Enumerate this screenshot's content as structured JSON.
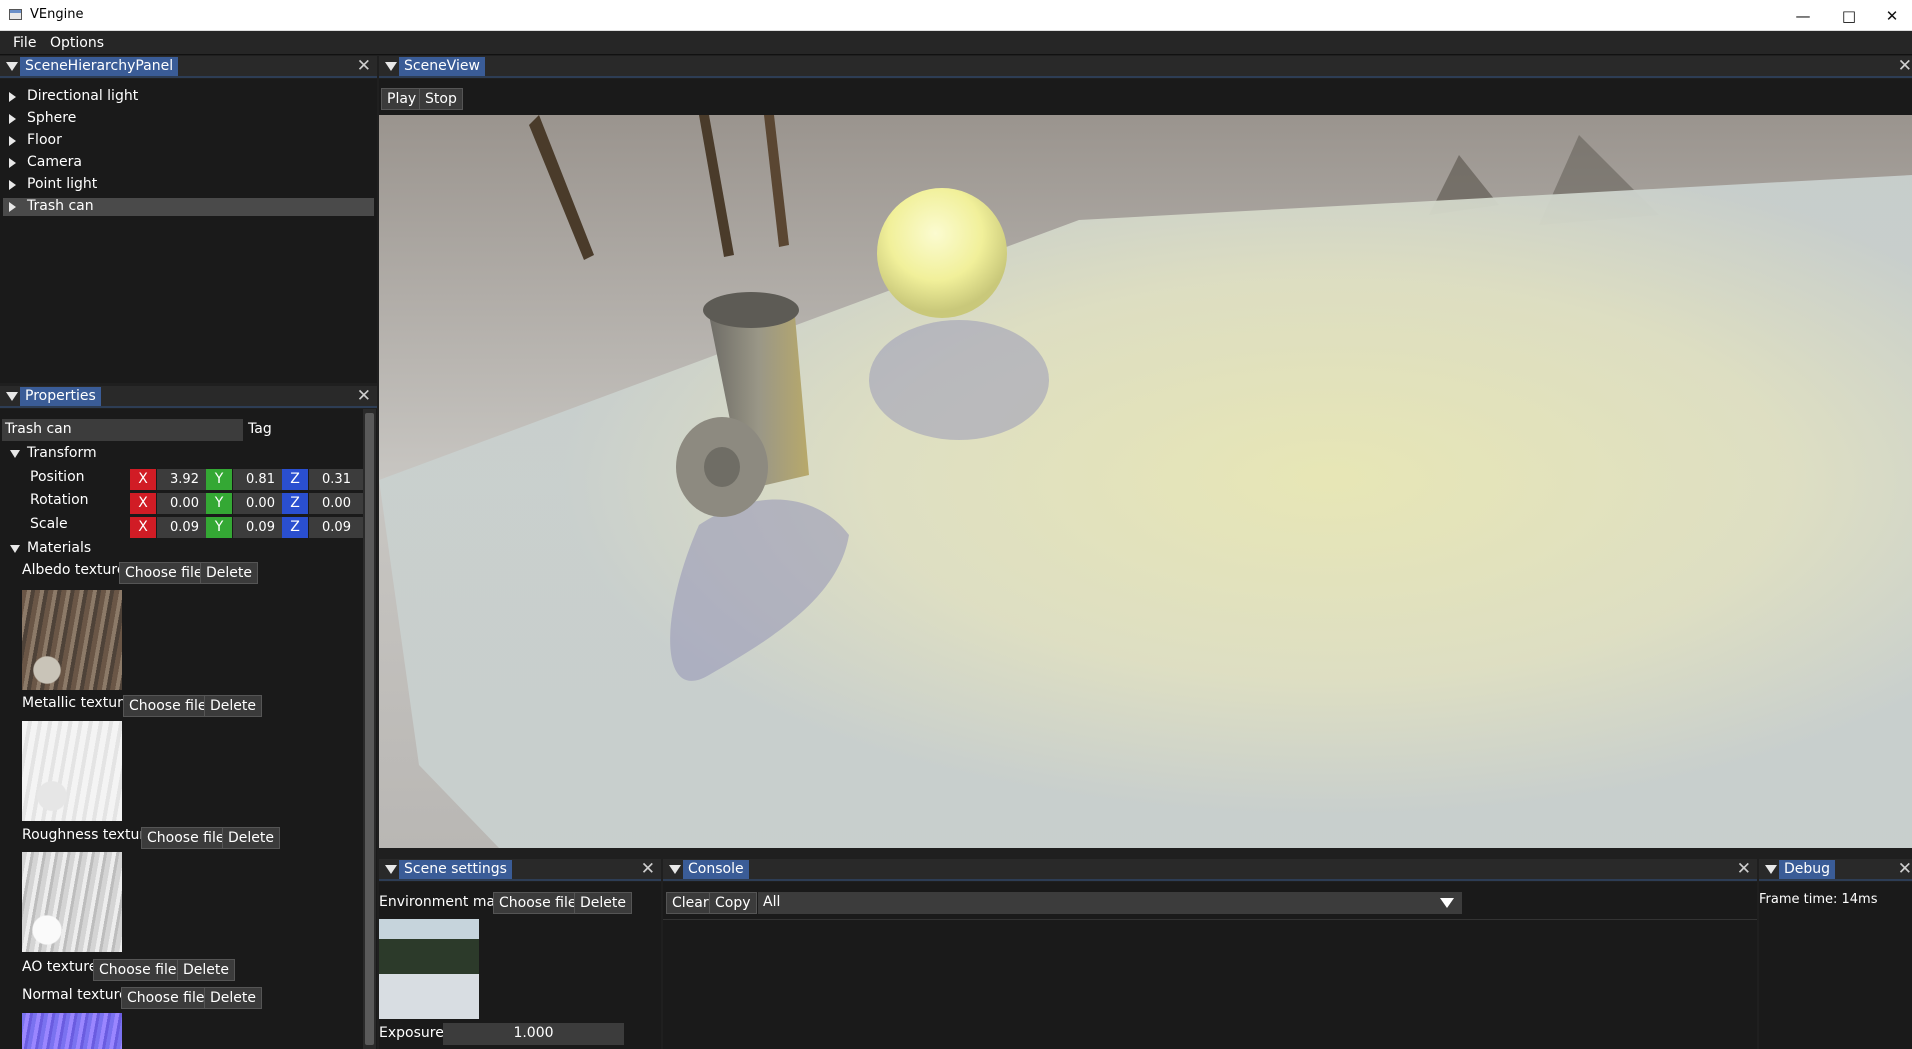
{
  "window": {
    "title": "VEngine"
  },
  "menu": {
    "file": "File",
    "options": "Options"
  },
  "hierarchy": {
    "tab": "SceneHierarchyPanel",
    "items": [
      {
        "label": "Directional light"
      },
      {
        "label": "Sphere"
      },
      {
        "label": "Floor"
      },
      {
        "label": "Camera"
      },
      {
        "label": "Point light"
      },
      {
        "label": "Trash can"
      }
    ],
    "selected": "Trash can"
  },
  "properties": {
    "tab": "Properties",
    "name_value": "Trash can",
    "tag_label": "Tag",
    "transform": {
      "title": "Transform",
      "rows": [
        {
          "label": "Position",
          "x": "3.92",
          "y": "0.81",
          "z": "0.31"
        },
        {
          "label": "Rotation",
          "x": "0.00",
          "y": "0.00",
          "z": "0.00"
        },
        {
          "label": "Scale",
          "x": "0.09",
          "y": "0.09",
          "z": "0.09"
        }
      ],
      "axis_x": "X",
      "axis_y": "Y",
      "axis_z": "Z"
    },
    "materials": {
      "title": "Materials",
      "albedo": "Albedo texture",
      "metallic": "Metallic texture",
      "roughness": "Roughness texture",
      "ao": "AO texture",
      "normal": "Normal texture",
      "choose": "Choose file",
      "delete": "Delete"
    }
  },
  "sceneview": {
    "tab": "SceneView",
    "play": "Play",
    "stop": "Stop"
  },
  "scene_settings": {
    "tab": "Scene settings",
    "env_label": "Environment map",
    "choose": "Choose file",
    "delete": "Delete",
    "exposure_label": "Exposure",
    "exposure_value": "1.000"
  },
  "console": {
    "tab": "Console",
    "clear": "Clear",
    "copy": "Copy",
    "filter": "All"
  },
  "debug": {
    "tab": "Debug",
    "frame_time": "Frame time: 14ms"
  },
  "colors": {
    "accent": "#3a5c97",
    "axis_x": "#d11c25",
    "axis_y": "#34a834",
    "axis_z": "#2a4fd0"
  }
}
